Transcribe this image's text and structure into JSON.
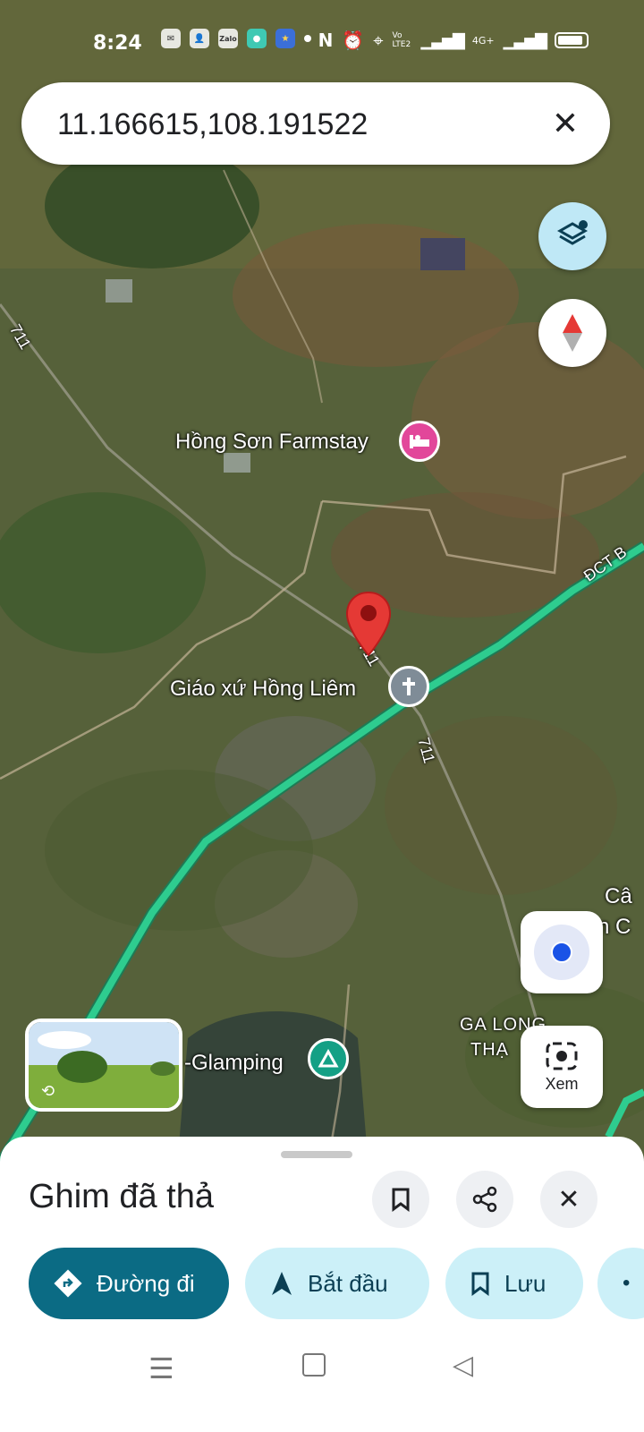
{
  "status_bar": {
    "time": "8:24",
    "notif_icons": [
      "messenger-icon",
      "person-icon",
      "zalo-icon",
      "chat-icon",
      "star-app-icon",
      "dot-icon"
    ],
    "zalo_text": "Zalo",
    "network": "4G+",
    "volte": "Vo LTE2"
  },
  "search": {
    "value": "11.166615,108.191522"
  },
  "map_labels": {
    "farmstay": "Hồng Sơn Farmstay",
    "church": "Giáo xứ Hồng Liêm",
    "glamping": "-Glamping",
    "station_1": "GA LONG",
    "station_2": "THẠ",
    "road_711_a": "711",
    "road_711_b": "711",
    "road_711_c": "711",
    "highway": "ĐCT B",
    "edge_1": "Câ",
    "edge_2": "n C"
  },
  "buttons": {
    "xem": "Xem"
  },
  "sheet": {
    "title": "Ghim đã thả",
    "directions": "Đường đi",
    "start": "Bắt đầu",
    "save": "Lưu"
  },
  "colors": {
    "primary": "#0b6b84",
    "secondary_bg": "#ccf0f8",
    "pin": "#e53935",
    "highway": "#2ecc8f"
  }
}
